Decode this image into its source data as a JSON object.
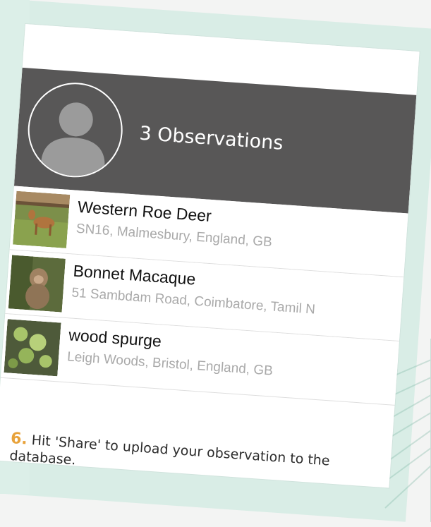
{
  "header": {
    "observation_count_label": "3 Observations"
  },
  "observations": [
    {
      "title": "Western Roe Deer",
      "location": "SN16, Malmesbury, England, GB",
      "thumb_icon": "deer-photo"
    },
    {
      "title": "Bonnet Macaque",
      "location": "51 Sambdam Road, Coimbatore, Tamil N",
      "thumb_icon": "macaque-photo"
    },
    {
      "title": "wood spurge",
      "location": "Leigh Woods, Bristol, England, GB",
      "thumb_icon": "plant-photo"
    }
  ],
  "caption": {
    "step_number": "6.",
    "text": " Hit 'Share' to upload your observation to the database."
  },
  "colors": {
    "header_bg": "#585757",
    "card_bg": "#d9ede6",
    "step_accent": "#e8a23a",
    "subtitle_gray": "#a9a9a9"
  }
}
